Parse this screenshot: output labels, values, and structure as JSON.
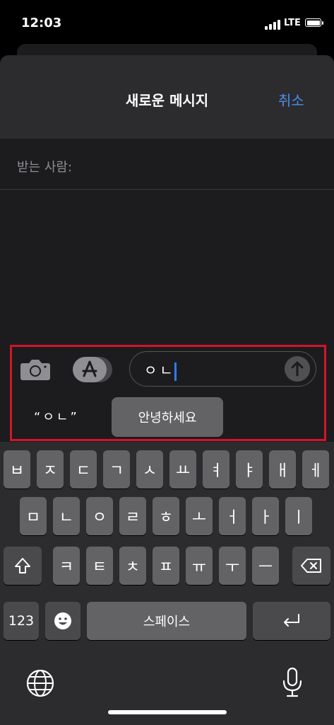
{
  "status": {
    "time": "12:03",
    "network": "LTE"
  },
  "nav": {
    "title": "새로운 메시지",
    "cancel": "취소"
  },
  "compose": {
    "to_label": "받는 사람:",
    "input_value": "ㅇㄴ"
  },
  "suggestions": {
    "quoted": "“ㅇㄴ”",
    "word": "안녕하세요"
  },
  "keyboard": {
    "row1": [
      "ㅂ",
      "ㅈ",
      "ㄷ",
      "ㄱ",
      "ㅅ",
      "ㅛ",
      "ㅕ",
      "ㅑ",
      "ㅐ",
      "ㅔ"
    ],
    "row2": [
      "ㅁ",
      "ㄴ",
      "ㅇ",
      "ㄹ",
      "ㅎ",
      "ㅗ",
      "ㅓ",
      "ㅏ",
      "ㅣ"
    ],
    "row3": [
      "ㅋ",
      "ㅌ",
      "ㅊ",
      "ㅍ",
      "ㅠ",
      "ㅜ",
      "ㅡ"
    ],
    "numbers": "123",
    "space": "스페이스"
  },
  "icons": [
    "camera-icon",
    "app-store-icon",
    "send-arrow-icon",
    "shift-icon",
    "backspace-icon",
    "emoji-icon",
    "return-icon",
    "globe-icon",
    "microphone-icon"
  ],
  "colors": {
    "accent": "#4a8df0",
    "highlight": "#d3142a",
    "cursor": "#2f7cf6"
  }
}
